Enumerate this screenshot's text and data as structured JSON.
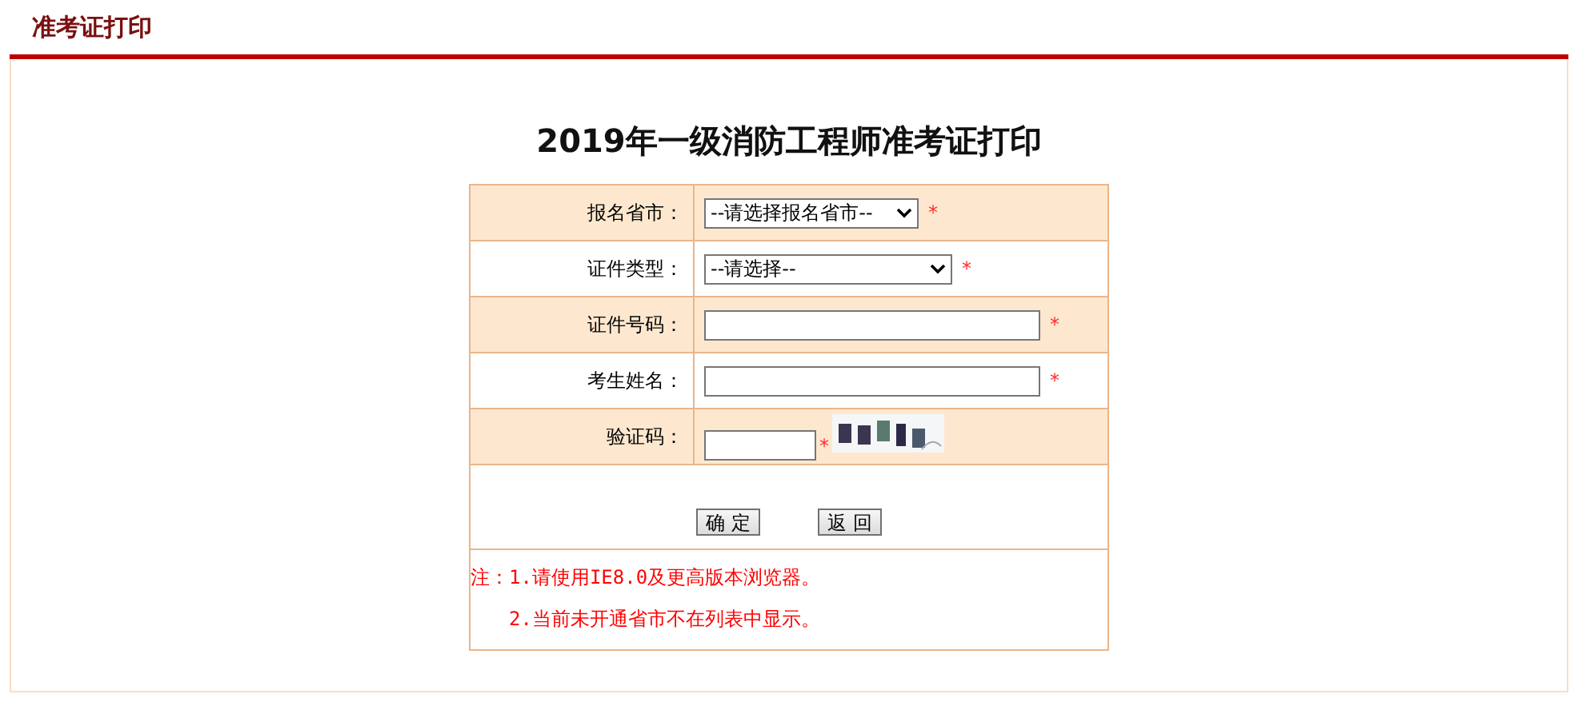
{
  "header": {
    "title": "准考证打印"
  },
  "heading": "2019年一级消防工程师准考证打印",
  "fields": [
    {
      "kind": "select",
      "label": "报名省市：",
      "value": "--请选择报名省市--",
      "required_mark": "*"
    },
    {
      "kind": "select",
      "label": "证件类型：",
      "value": "--请选择--",
      "required_mark": "*"
    },
    {
      "kind": "text",
      "label": "证件号码：",
      "required_mark": "*"
    },
    {
      "kind": "text",
      "label": "考生姓名：",
      "required_mark": "*"
    },
    {
      "kind": "captcha",
      "label": "验证码：",
      "required_mark": "*"
    }
  ],
  "buttons": [
    "确 定",
    "返 回"
  ],
  "notes": [
    {
      "prefix": "注：",
      "text": "1.请使用IE8.0及更高版本浏览器。"
    },
    {
      "text": "2.当前未开通省市不在列表中显示。"
    }
  ]
}
